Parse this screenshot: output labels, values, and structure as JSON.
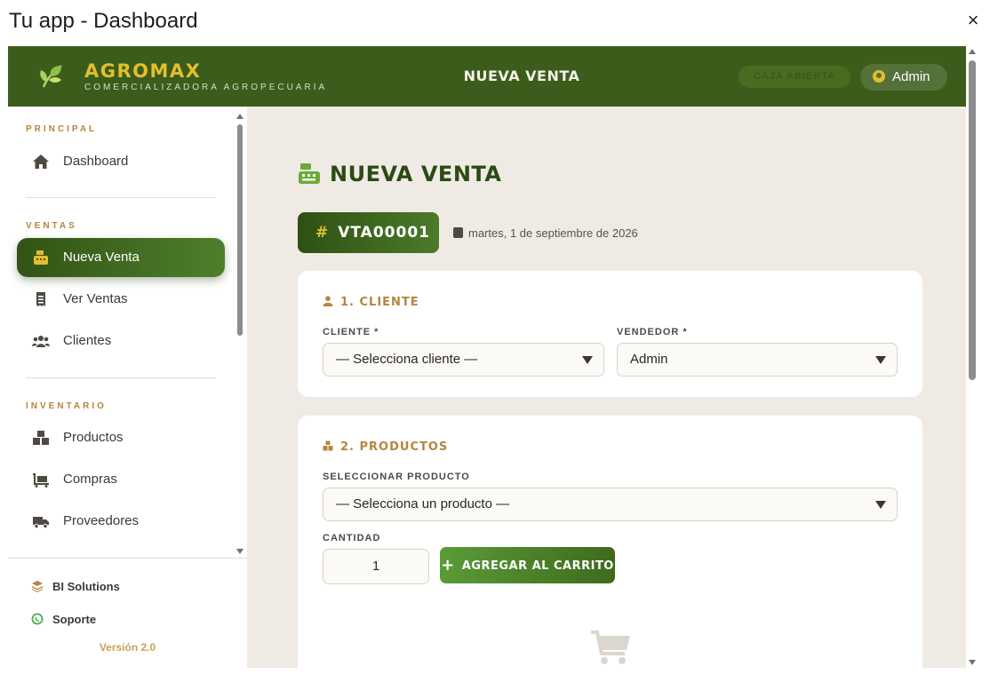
{
  "window": {
    "title": "Tu app - Dashboard",
    "close_icon": "×"
  },
  "header": {
    "brand": "AGROMAX",
    "brand_sub": "COMERCIALIZADORA AGROPECUARIA",
    "title": "NUEVA VENTA",
    "caja_label": "CAJA ABIERTA",
    "user_label": "Admin"
  },
  "sidebar": {
    "sections": {
      "principal": "PRINCIPAL",
      "ventas": "VENTAS",
      "inventario": "INVENTARIO"
    },
    "items": {
      "dashboard": "Dashboard",
      "nueva_venta": "Nueva Venta",
      "ver_ventas": "Ver Ventas",
      "clientes": "Clientes",
      "productos": "Productos",
      "compras": "Compras",
      "proveedores": "Proveedores"
    },
    "footer": {
      "bi": "BI Solutions",
      "soporte": "Soporte",
      "version": "Versión 2.0"
    }
  },
  "main": {
    "title": "NUEVA VENTA",
    "sale_code": "VTA00001",
    "hash": "#",
    "date": "martes, 1 de septiembre de 2026",
    "cliente_card": {
      "title": "1. CLIENTE",
      "cliente_label": "CLIENTE *",
      "cliente_value": "— Selecciona cliente —",
      "vendedor_label": "VENDEDOR *",
      "vendedor_value": "Admin"
    },
    "productos_card": {
      "title": "2. PRODUCTOS",
      "producto_label": "SELECCIONAR PRODUCTO",
      "producto_value": "— Selecciona un producto —",
      "cantidad_label": "CANTIDAD",
      "cantidad_value": "1",
      "add_button": "AGREGAR AL CARRITO",
      "add_plus": "+"
    }
  },
  "colors": {
    "primary": "#3c5c1c",
    "accent": "#e2bf2c",
    "section": "#b7843e"
  }
}
